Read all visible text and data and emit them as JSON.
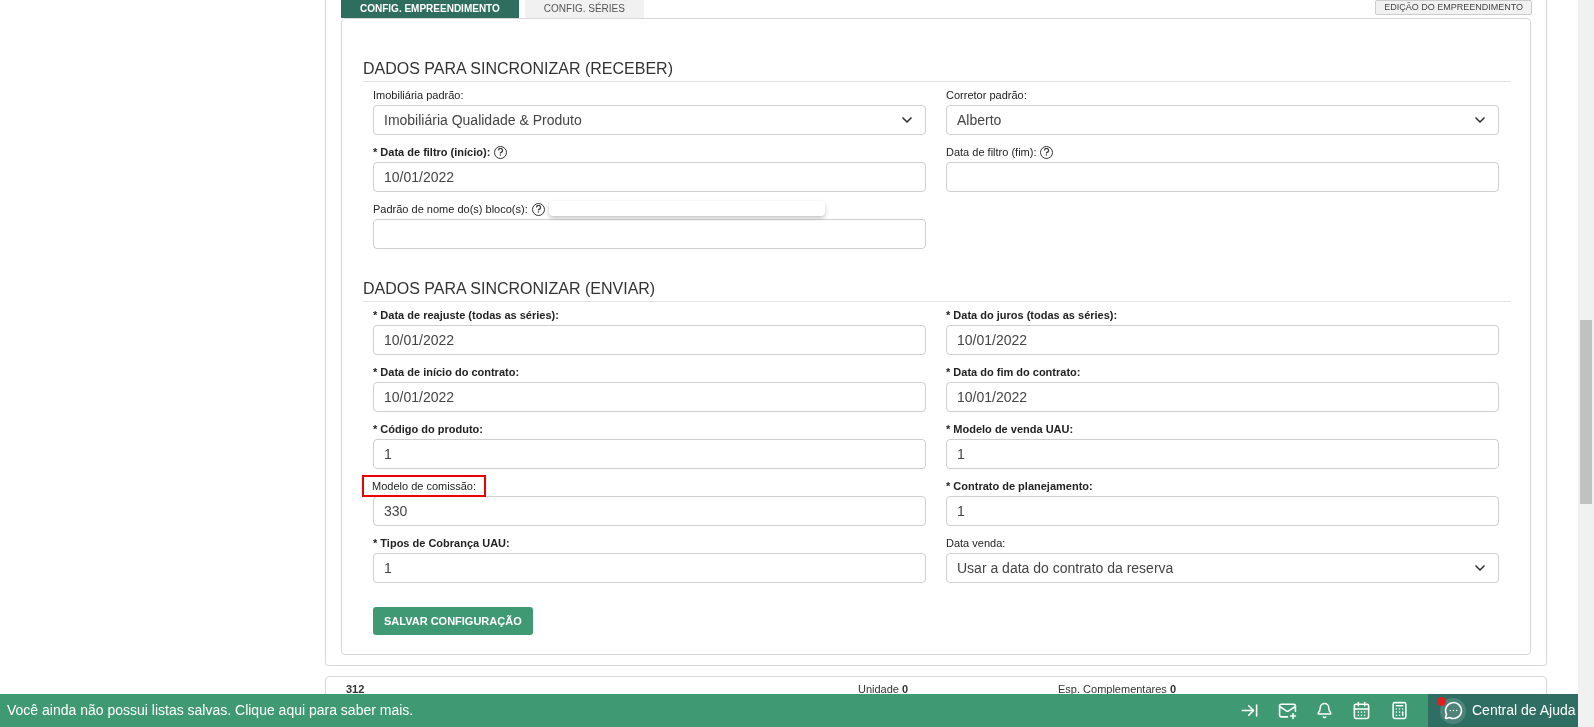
{
  "tabs": [
    {
      "label": "CONFIG. EMPREENDIMENTO",
      "selected": true
    },
    {
      "label": "CONFIG. SÉRIES",
      "selected": false
    }
  ],
  "edit_button": "EDIÇÃO DO EMPREENDIMENTO",
  "sections": [
    {
      "title": "DADOS PARA SINCRONIZAR (RECEBER)",
      "rows": [
        [
          {
            "label": "Imobiliária padrão:",
            "required": false,
            "kind": "select",
            "value": "Imobiliária Qualidade & Produto"
          },
          {
            "label": "Corretor padrão:",
            "required": false,
            "kind": "select",
            "value": "Alberto"
          }
        ],
        [
          {
            "label": "* Data de filtro (início):",
            "required": true,
            "help": true,
            "kind": "text",
            "value": "10/01/2022"
          },
          {
            "label": "Data de filtro (fim):",
            "required": false,
            "help": true,
            "kind": "text"
          }
        ],
        [
          {
            "label": "Padrão de nome do(s) bloco(s):",
            "required": false,
            "help": true,
            "tooltip_open": true,
            "kind": "text"
          }
        ]
      ]
    },
    {
      "title": "DADOS PARA SINCRONIZAR (ENVIAR)",
      "rows": [
        [
          {
            "label": "* Data de reajuste (todas as séries):",
            "required": true,
            "kind": "text",
            "value": "10/01/2022"
          },
          {
            "label": "* Data do juros (todas as séries):",
            "required": true,
            "kind": "text",
            "value": "10/01/2022"
          }
        ],
        [
          {
            "label": "* Data de início do contrato:",
            "required": true,
            "kind": "text",
            "value": "10/01/2022"
          },
          {
            "label": "* Data do fim do contrato:",
            "required": true,
            "kind": "text",
            "value": "10/01/2022"
          }
        ],
        [
          {
            "label": "* Código do produto:",
            "required": true,
            "kind": "text",
            "value": "1"
          },
          {
            "label": "* Modelo de venda UAU:",
            "required": true,
            "kind": "text",
            "value": "1"
          }
        ],
        [
          {
            "label": "Modelo de comissão:",
            "required": false,
            "highlighted": true,
            "kind": "text",
            "value": "330"
          },
          {
            "label": "* Contrato de planejamento:",
            "required": true,
            "kind": "text",
            "value": "1"
          }
        ],
        [
          {
            "label": "* Tipos de Cobrança UAU:",
            "required": true,
            "kind": "text",
            "value": "1"
          },
          {
            "label": "Data venda:",
            "required": false,
            "kind": "select",
            "value": "Usar a data do contrato da reserva"
          }
        ]
      ]
    }
  ],
  "save_button": "SALVAR CONFIGURAÇÃO",
  "summary": {
    "title": "312",
    "items": [
      {
        "label": "Unidade",
        "value": "0"
      },
      {
        "label": "Esp. Complementares",
        "value": "0"
      }
    ]
  },
  "footer": {
    "message": "Você ainda não possui listas salvas. Clique aqui para saber mais.",
    "help": "Central de Ajuda",
    "notification": true
  }
}
